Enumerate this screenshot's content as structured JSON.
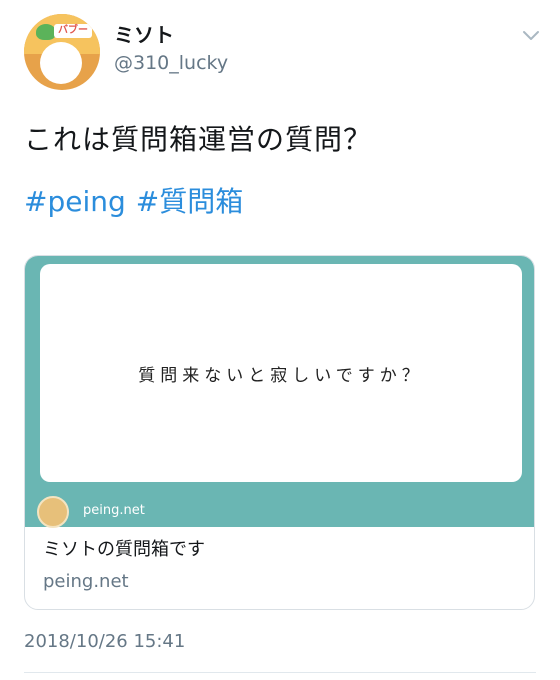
{
  "author": {
    "display_name": "ミソト",
    "handle": "@310_lucky",
    "avatar_badge": "バブー"
  },
  "tweet": {
    "text": "これは質問箱運営の質問？",
    "hashtags": [
      "#peing",
      "#質問箱"
    ]
  },
  "card": {
    "question": "質問来ないと寂しいですか？",
    "media_domain": "peing.net",
    "title": "ミソトの質問箱です",
    "domain": "peing.net"
  },
  "timestamp": "2018/10/26 15:41",
  "icons": {
    "menu": "chevron-down-icon",
    "site_logo": "peing-logo-icon"
  },
  "colors": {
    "hashtag": "#2b8ddc",
    "card_accent": "#6ab6b3",
    "secondary_text": "#657786"
  }
}
